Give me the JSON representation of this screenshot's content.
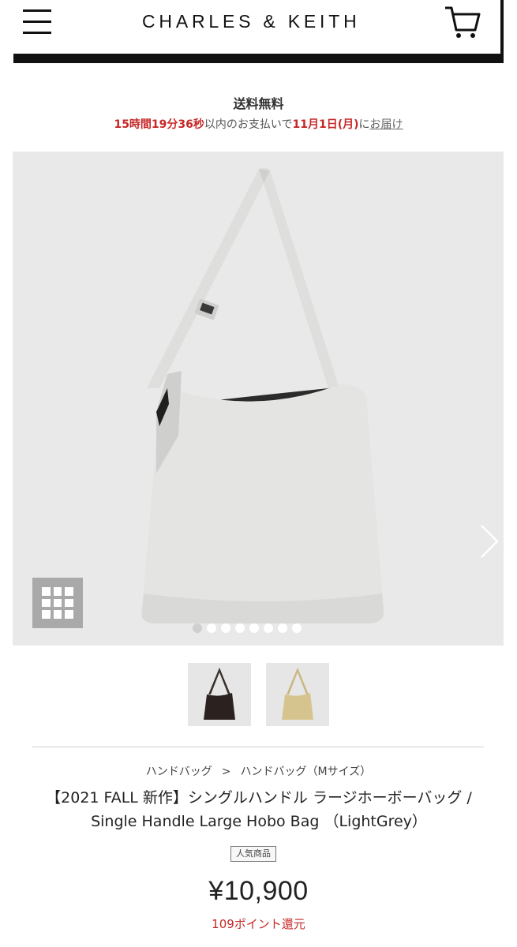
{
  "header": {
    "logo": "CHARLES & KEITH",
    "menu_icon": "hamburger-menu-icon",
    "cart_icon": "shopping-cart-icon"
  },
  "shipping": {
    "title": "送料無料",
    "countdown": "15時間19分36秒",
    "within": "以内のお支払いで",
    "date": "11月1日(月)",
    "ni": "に",
    "deliver_link": "お届け"
  },
  "gallery": {
    "next_icon": "chevron-right-icon",
    "grid_icon": "grid-view-icon",
    "dot_count": 8,
    "active_dot": 0,
    "thumbnails": [
      {
        "color_name": "dark-brown",
        "bag_color": "#2b2220"
      },
      {
        "color_name": "beige",
        "bag_color": "#d6c48e"
      }
    ]
  },
  "product": {
    "breadcrumb": [
      "ハンドバッグ",
      "ハンドバッグ（Mサイズ）"
    ],
    "breadcrumb_sep": ">",
    "title": "【2021 FALL 新作】シングルハンドル ラージホーボーバッグ / Single Handle Large Hobo Bag （LightGrey）",
    "badge": "人気商品",
    "price": "¥10,900",
    "points": "109ポイント還元"
  },
  "colors": {
    "accent_red": "#c62828",
    "hero_bg": "#e9e9e9",
    "bag_main": "#e4e4e2"
  }
}
